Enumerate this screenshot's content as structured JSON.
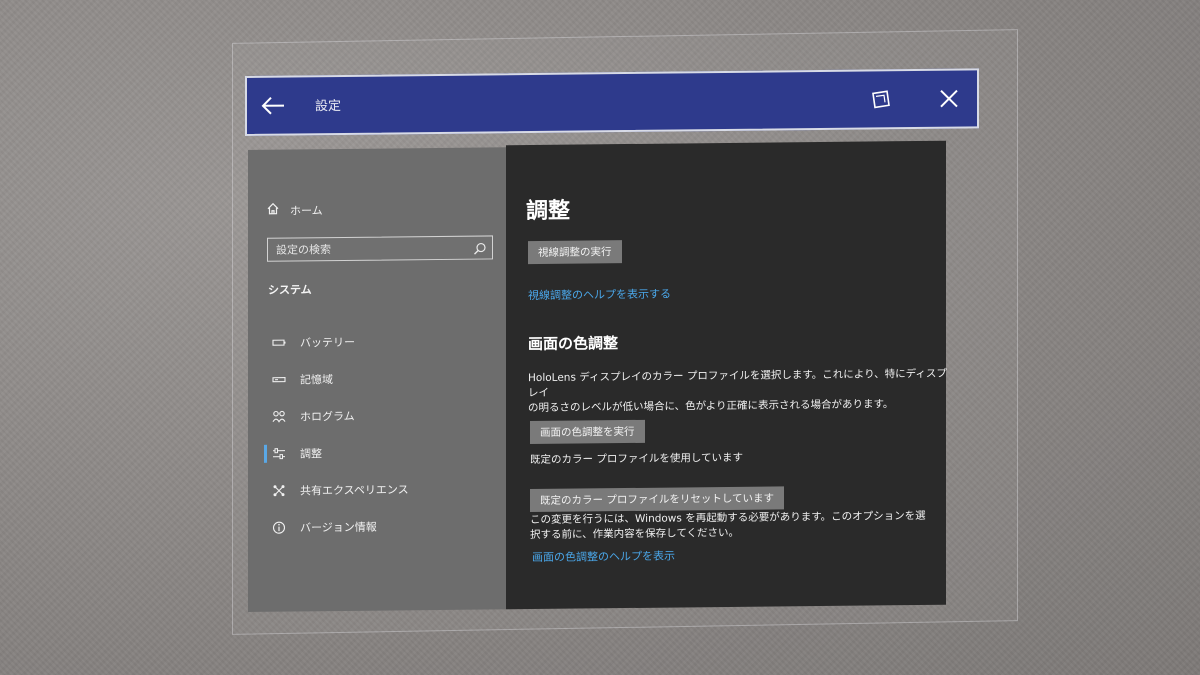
{
  "titlebar": {
    "title": "設定"
  },
  "sidebar": {
    "home_label": "ホーム",
    "search_placeholder": "設定の検索",
    "section_label": "システム",
    "items": [
      {
        "label": "バッテリー",
        "icon": "battery-icon"
      },
      {
        "label": "記憶域",
        "icon": "storage-icon"
      },
      {
        "label": "ホログラム",
        "icon": "hologram-icon"
      },
      {
        "label": "調整",
        "icon": "calibration-icon",
        "selected": true
      },
      {
        "label": "共有エクスペリエンス",
        "icon": "shared-experiences-icon"
      },
      {
        "label": "バージョン情報",
        "icon": "info-icon"
      }
    ]
  },
  "main": {
    "page_title": "調整",
    "eye_calibration_button": "視線調整の実行",
    "eye_calibration_help_link": "視線調整のヘルプを表示する",
    "color_section_heading": "画面の色調整",
    "color_description_line1": "HoloLens ディスプレイのカラー プロファイルを選択します。これにより、特にディスプレイ",
    "color_description_line2": "の明るさのレベルが低い場合に、色がより正確に表示される場合があります。",
    "run_color_calibration_button": "画面の色調整を実行",
    "default_profile_status": "既定のカラー プロファイルを使用しています",
    "reset_profile_button": "既定のカラー プロファイルをリセットしています",
    "restart_notice_line1": "この変更を行うには、Windows を再起動する必要があります。このオプションを選",
    "restart_notice_line2": "択する前に、作業内容を保存してください。",
    "color_calibration_help_link": "画面の色調整のヘルプを表示"
  },
  "colors": {
    "titlebar_bg": "#2e3a8c",
    "sidebar_bg": "#6d6d6d",
    "content_bg": "#2a2a2a",
    "link": "#4aa6e8",
    "selection_accent": "#5aa8e6"
  }
}
